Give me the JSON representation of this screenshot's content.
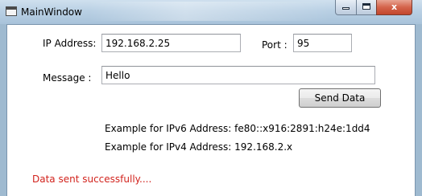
{
  "window": {
    "title": "MainWindow",
    "close_glyph": "x"
  },
  "form": {
    "ip_label": "IP Address:",
    "ip_value": "192.168.2.25",
    "port_label": "Port :",
    "port_value": "95",
    "message_label": "Message :",
    "message_value": "Hello",
    "send_label": "Send Data",
    "example_ipv6": "Example for IPv6 Address: fe80::x916:2891:h24e:1dd4",
    "example_ipv4": "Example for IPv4 Address: 192.168.2.x",
    "status": "Data sent successfully...."
  },
  "colors": {
    "status": "#d2231d",
    "frame": "#9fbad0"
  },
  "icons": {
    "app": "window-icon",
    "minimize": "minimize-icon",
    "maximize": "maximize-icon",
    "close": "close-icon"
  }
}
